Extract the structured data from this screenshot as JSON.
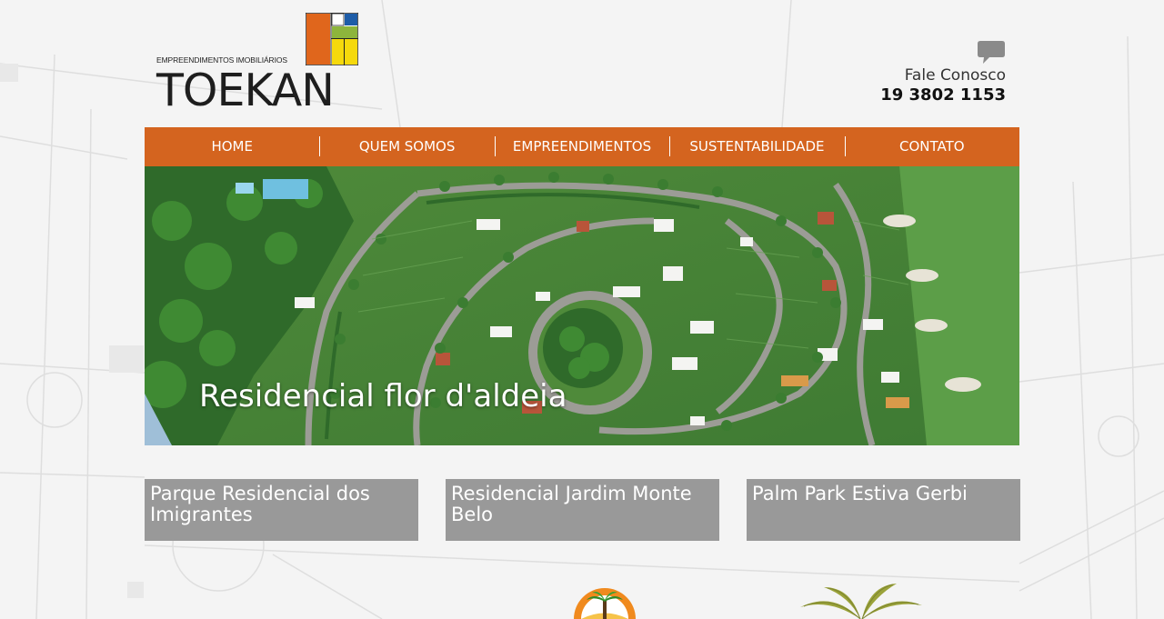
{
  "brand": {
    "subtitle": "EMPREENDIMENTOS IMOBILIÁRIOS",
    "name": "TOEKAN",
    "colors": {
      "orange": "#e0661c",
      "green": "#8db53c",
      "yellow": "#f5d90c",
      "blue": "#1e5da8"
    }
  },
  "contact": {
    "label": "Fale Conosco",
    "phone": "19 3802 1153",
    "icon": "chat-bubble-icon"
  },
  "nav": {
    "color": "#d4641f",
    "items": [
      {
        "label": "HOME"
      },
      {
        "label": "QUEM SOMOS"
      },
      {
        "label": "EMPREENDIMENTOS"
      },
      {
        "label": "SUSTENTABILIDADE"
      },
      {
        "label": "CONTATO"
      }
    ]
  },
  "hero": {
    "caption": "Residencial flor d'aldeia"
  },
  "cards": [
    {
      "title": "Parque Residencial dos Imigrantes"
    },
    {
      "title": "Residencial Jardim Monte Belo"
    },
    {
      "title": "Palm Park Estiva Gerbi"
    }
  ]
}
